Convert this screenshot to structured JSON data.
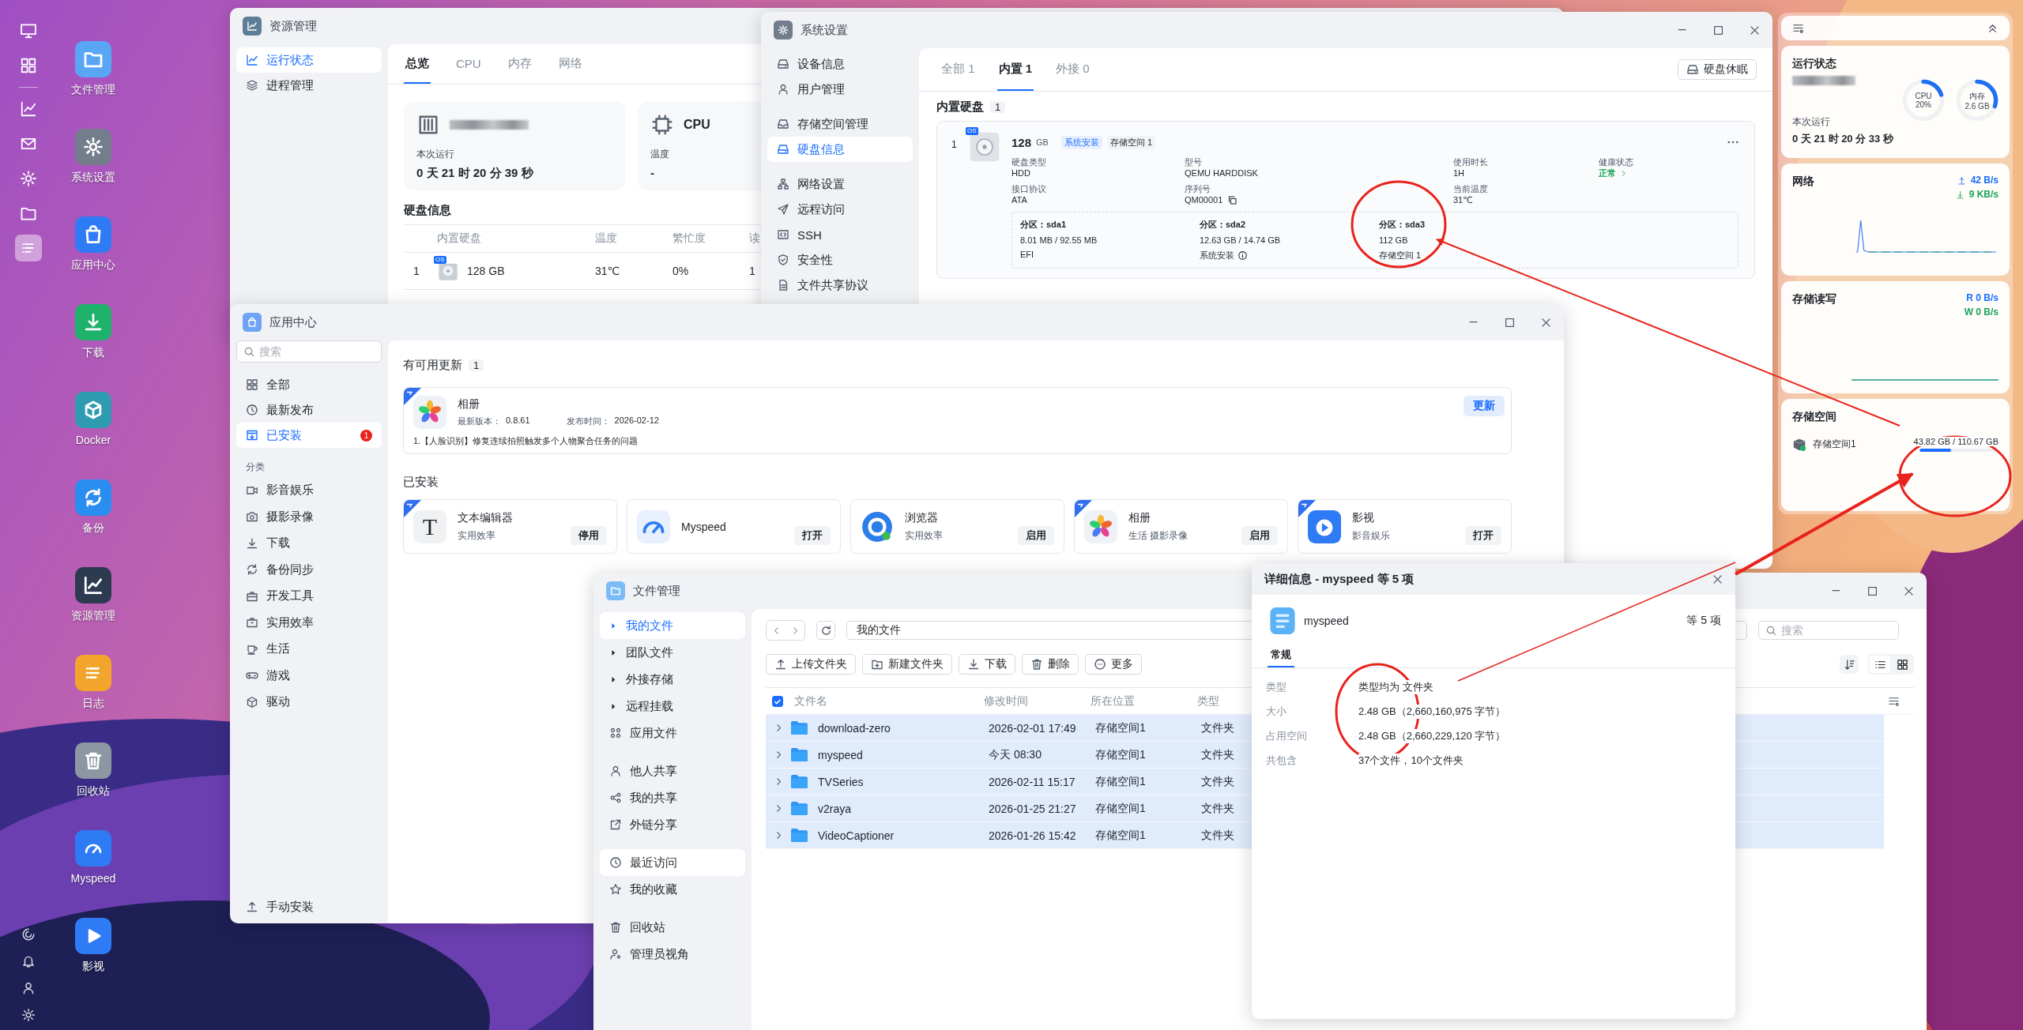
{
  "taskbar": [
    {
      "selected": false
    },
    {
      "selected": false
    },
    {
      "selected": false
    },
    {
      "selected": false
    },
    {
      "selected": false
    },
    {
      "selected": false
    },
    {
      "selected": true
    }
  ],
  "desktop_icons": [
    {
      "label": "文件管理"
    },
    {
      "label": "系统设置"
    },
    {
      "label": "应用中心"
    },
    {
      "label": "下载"
    },
    {
      "label": "Docker"
    },
    {
      "label": "备份"
    },
    {
      "label": "资源管理"
    },
    {
      "label": "日志"
    },
    {
      "label": "回收站"
    },
    {
      "label": "Myspeed"
    },
    {
      "label": "影视"
    }
  ],
  "resource_window": {
    "title": "资源管理",
    "sidebar": [
      {
        "label": "运行状态",
        "selected": true
      },
      {
        "label": "进程管理",
        "selected": false
      }
    ],
    "tabs": [
      {
        "label": "总览",
        "selected": true
      },
      {
        "label": "CPU",
        "selected": false
      },
      {
        "label": "内存",
        "selected": false
      },
      {
        "label": "网络",
        "selected": false
      }
    ],
    "device_card": {
      "uptime_label": "本次运行",
      "uptime": "0 天 21 时 20 分 39 秒"
    },
    "cpu_card": {
      "title": "CPU",
      "temp_label": "温度",
      "temp": "-"
    },
    "disk_title": "硬盘信息",
    "disk_table": {
      "columns": [
        "内置硬盘",
        "温度",
        "繁忙度",
        "读"
      ],
      "rows": [
        {
          "index": "1",
          "badge": "OS",
          "name": "128 GB",
          "temp": "31℃",
          "busy": "0%",
          "read": "1"
        }
      ]
    }
  },
  "settings_window": {
    "title": "系统设置",
    "sidebar_groups": [
      {
        "items": [
          {
            "label": "设备信息",
            "selected": false
          },
          {
            "label": "用户管理",
            "selected": false
          }
        ]
      },
      {
        "items": [
          {
            "label": "存储空间管理",
            "selected": false
          },
          {
            "label": "硬盘信息",
            "selected": true
          }
        ]
      },
      {
        "items": [
          {
            "label": "网络设置",
            "selected": false
          },
          {
            "label": "远程访问",
            "selected": false
          },
          {
            "label": "SSH",
            "selected": false
          },
          {
            "label": "安全性",
            "selected": false
          },
          {
            "label": "文件共享协议",
            "selected": false
          }
        ]
      }
    ],
    "tabs": [
      {
        "label": "全部 1",
        "selected": false
      },
      {
        "label": "内置 1",
        "selected": true
      },
      {
        "label": "外接 0",
        "selected": false
      }
    ],
    "sleep_button": "硬盘休眠",
    "section_title": "内置硬盘",
    "section_count": "1",
    "disk": {
      "index": "1",
      "badge": "OS",
      "size": "128",
      "unit": "GB",
      "tags": [
        {
          "label": "系统安装",
          "kind": "primary"
        },
        {
          "label": "存储空间 1",
          "kind": "plain"
        }
      ],
      "fields": [
        {
          "label": "硬盘类型",
          "value": "HDD",
          "kind": "text"
        },
        {
          "label": "型号",
          "value": "QEMU HARDDISK",
          "kind": "text"
        },
        {
          "label": "使用时长",
          "value": "1H",
          "kind": "text"
        },
        {
          "label": "健康状态",
          "value": "正常",
          "kind": "status"
        },
        {
          "label": "接口协议",
          "value": "ATA",
          "kind": "text"
        },
        {
          "label": "序列号",
          "value": "QM00001",
          "kind": "copyable"
        },
        {
          "label": "当前温度",
          "value": "31℃",
          "kind": "text"
        }
      ],
      "partitions": [
        {
          "label": "分区：",
          "name": "sda1",
          "usage": "8.01 MB / 92.55 MB",
          "role": "EFI",
          "info": false
        },
        {
          "label": "分区：",
          "name": "sda2",
          "usage": "12.63 GB / 14.74 GB",
          "role": "系统安装",
          "info": true
        },
        {
          "label": "分区：",
          "name": "sda3",
          "usage": "112 GB",
          "role": "存储空间 1",
          "info": false
        }
      ]
    }
  },
  "app_center": {
    "title": "应用中心",
    "search_placeholder": "搜索",
    "nav": [
      {
        "label": "全部",
        "selected": false
      },
      {
        "label": "最新发布",
        "selected": false
      },
      {
        "label": "已安装",
        "selected": true,
        "badge": "1"
      }
    ],
    "category_title": "分类",
    "categories": [
      {
        "label": "影音娱乐",
        "selected": false
      },
      {
        "label": "摄影录像",
        "selected": false
      },
      {
        "label": "下载",
        "selected": false
      },
      {
        "label": "备份同步",
        "selected": false
      },
      {
        "label": "开发工具",
        "selected": false
      },
      {
        "label": "实用效率",
        "selected": false
      },
      {
        "label": "生活",
        "selected": false
      },
      {
        "label": "游戏",
        "selected": false
      },
      {
        "label": "驱动",
        "selected": false
      }
    ],
    "manual_install": "手动安装",
    "updates_title": "有可用更新",
    "updates_count": "1",
    "updates": [
      {
        "name": "相册",
        "version_label": "最新版本：",
        "version": "0.8.61",
        "date_label": "发布时间：",
        "date": "2026-02-12",
        "note": "1.【人脸识别】修复连续拍照触发多个人物聚合任务的问题",
        "button": "更新",
        "ribbon": true
      }
    ],
    "installed_title": "已安装",
    "installed": [
      {
        "name": "文本编辑器",
        "desc": "实用效率",
        "button": "停用",
        "ribbon": true,
        "icon_text": "T"
      },
      {
        "name": "Myspeed",
        "button": "打开",
        "ribbon": false
      },
      {
        "name": "浏览器",
        "desc": "实用效率",
        "button": "启用",
        "ribbon": false
      },
      {
        "name": "相册",
        "desc": "生活 摄影录像",
        "button": "启用",
        "ribbon": true
      },
      {
        "name": "影视",
        "desc": "影音娱乐",
        "button": "打开",
        "ribbon": true
      }
    ]
  },
  "file_manager": {
    "title": "文件管理",
    "sidebar_groups": [
      {
        "items": [
          {
            "label": "我的文件",
            "kind": "tree",
            "selected": true,
            "hovered": false
          },
          {
            "label": "团队文件",
            "kind": "tree",
            "selected": false,
            "hovered": false
          },
          {
            "label": "外接存储",
            "kind": "tree",
            "selected": false,
            "hovered": false
          },
          {
            "label": "远程挂载",
            "kind": "tree",
            "selected": false,
            "hovered": false
          },
          {
            "label": "应用文件",
            "kind": "link",
            "selected": false,
            "hovered": false
          }
        ]
      },
      {
        "items": [
          {
            "label": "他人共享",
            "kind": "link",
            "selected": false,
            "hovered": false
          },
          {
            "label": "我的共享",
            "kind": "link",
            "selected": false,
            "hovered": false
          },
          {
            "label": "外链分享",
            "kind": "link",
            "selected": false,
            "hovered": false
          }
        ]
      },
      {
        "items": [
          {
            "label": "最近访问",
            "kind": "link",
            "selected": false,
            "hovered": true
          },
          {
            "label": "我的收藏",
            "kind": "link",
            "selected": false,
            "hovered": false
          }
        ]
      },
      {
        "items": [
          {
            "label": "回收站",
            "kind": "link",
            "selected": false,
            "hovered": false
          },
          {
            "label": "管理员视角",
            "kind": "link",
            "selected": false,
            "hovered": false
          }
        ]
      }
    ],
    "path": "我的文件",
    "search_placeholder": "搜索",
    "actions": [
      "上传文件夹",
      "新建文件夹",
      "下载",
      "删除",
      "更多"
    ],
    "header_checked": true,
    "columns": [
      "文件名",
      "修改时间",
      "所在位置",
      "类型"
    ],
    "rows": [
      {
        "name": "download-zero",
        "modified": "2026-02-01 17:49",
        "location": "存储空间1",
        "type": "文件夹",
        "selected": true
      },
      {
        "name": "myspeed",
        "modified": "今天 08:30",
        "location": "存储空间1",
        "type": "文件夹",
        "selected": true
      },
      {
        "name": "TVSeries",
        "modified": "2026-02-11 15:17",
        "location": "存储空间1",
        "type": "文件夹",
        "selected": true
      },
      {
        "name": "v2raya",
        "modified": "2026-01-25 21:27",
        "location": "存储空间1",
        "type": "文件夹",
        "selected": true
      },
      {
        "name": "VideoCaptioner",
        "modified": "2026-01-26 15:42",
        "location": "存储空间1",
        "type": "文件夹",
        "selected": true
      }
    ]
  },
  "details_dialog": {
    "title": "详细信息 - myspeed 等 5 项",
    "name": "myspeed",
    "count": "等 5 项",
    "tabs": [
      {
        "label": "常规",
        "selected": true
      }
    ],
    "rows": [
      {
        "label": "类型",
        "value": "类型均为 文件夹"
      },
      {
        "label": "大小",
        "value": "2.48 GB（2,660,160,975 字节）"
      },
      {
        "label": "占用空间",
        "value": "2.48 GB（2,660,229,120 字节）"
      },
      {
        "label": "共包含",
        "value": "37个文件，10个文件夹"
      }
    ]
  },
  "widgets": {
    "status": {
      "title": "运行状态",
      "gauges": [
        {
          "label": "CPU",
          "value": "20%",
          "level": 0.2
        },
        {
          "label": "内存",
          "value": "2.6 GB",
          "level": 0.3
        }
      ],
      "uptime_label": "本次运行",
      "uptime": "0 天 21 时 20 分 33 秒"
    },
    "network": {
      "title": "网络",
      "upload": "42 B/s",
      "download": "9 KB/s"
    },
    "disk_io": {
      "title": "存储读写",
      "read": "R 0 B/s",
      "write": "W 0 B/s"
    },
    "storage": {
      "title": "存储空间",
      "items": [
        {
          "name": "存储空间1",
          "usage": "43.82 GB / 110.67 GB",
          "level": 0.396
        }
      ]
    }
  }
}
